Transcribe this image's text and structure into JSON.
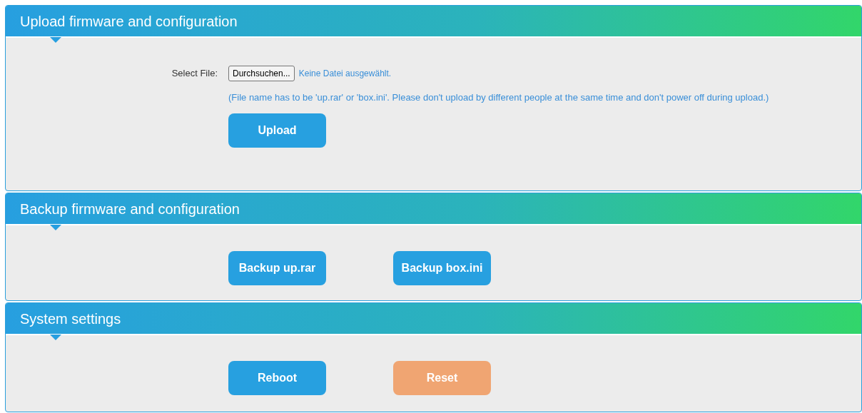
{
  "sections": [
    {
      "title": "Upload firmware and configuration",
      "file_select": {
        "label": "Select File:",
        "browse_button": "Durchsuchen...",
        "file_status": "Keine Datei ausgewählt."
      },
      "note": "(File name has to be 'up.rar' or 'box.ini'. Please don't upload by different people at the same time and don't power off during upload.)",
      "buttons": [
        {
          "label": "Upload",
          "kind": "primary"
        }
      ]
    },
    {
      "title": "Backup firmware and configuration",
      "buttons": [
        {
          "label": "Backup up.rar",
          "kind": "primary"
        },
        {
          "label": "Backup box.ini",
          "kind": "primary"
        }
      ]
    },
    {
      "title": "System settings",
      "buttons": [
        {
          "label": "Reboot",
          "kind": "primary"
        },
        {
          "label": "Reset",
          "kind": "warning"
        }
      ]
    }
  ]
}
